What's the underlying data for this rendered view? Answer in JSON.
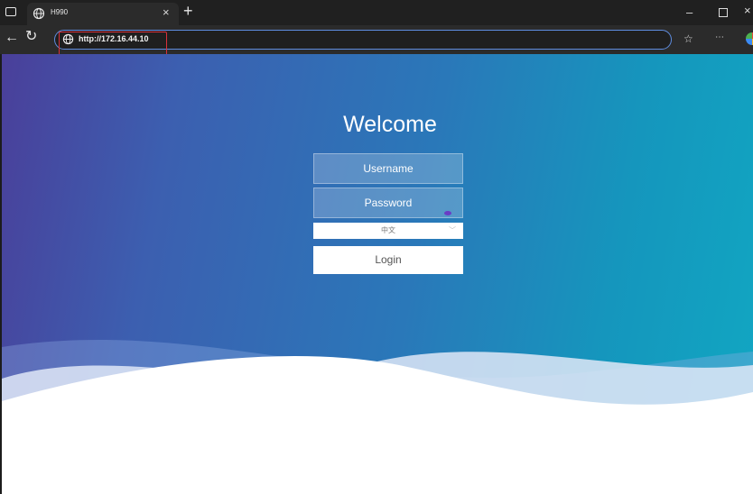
{
  "browser": {
    "tab_title": "H990",
    "tab_close": "×",
    "new_tab": "+",
    "url": "http://172.16.44.10",
    "window_controls": {
      "minimize": "–",
      "maximize": "",
      "close": "×"
    },
    "icons": [
      "tab-actions-icon",
      "globe-icon",
      "back-icon",
      "refresh-icon",
      "favorites-icon",
      "menu-icon",
      "profile-icon"
    ],
    "highlight_color": "#d8303a"
  },
  "login": {
    "title": "Welcome",
    "username_placeholder": "Username",
    "password_placeholder": "Password",
    "language_selected": "中文",
    "submit_label": "Login"
  },
  "colors": {
    "gradient_start": "#4a3f9a",
    "gradient_end": "#11a6c2",
    "field_bg": "rgba(255,255,255,0.22)"
  }
}
